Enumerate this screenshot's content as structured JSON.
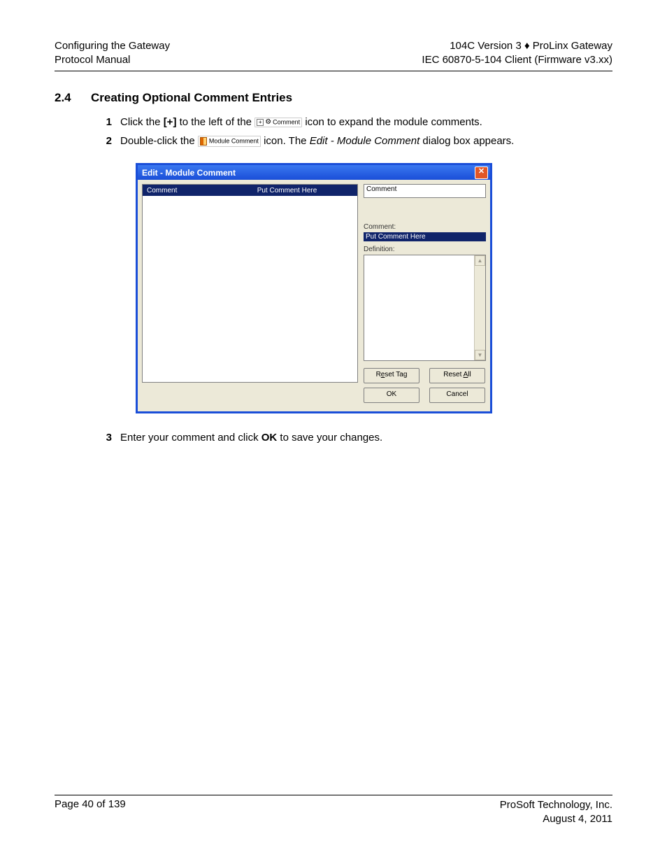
{
  "header": {
    "left_line1": "Configuring the  Gateway",
    "left_line2": "Protocol Manual",
    "right_line1": "104C Version 3 ♦ ProLinx Gateway",
    "right_line2": "IEC 60870-5-104 Client (Firmware v3.xx)"
  },
  "section": {
    "number": "2.4",
    "title": "Creating Optional Comment Entries"
  },
  "steps": {
    "s1a": "Click the ",
    "s1_bold1": "[+]",
    "s1b": " to the left of the  ",
    "icon1_label": "Comment",
    "s1c": "  icon to expand the module comments.",
    "s2a": "Double-click the  ",
    "icon2_label": "Module Comment",
    "s2b": "  icon. The ",
    "s2_italic": "Edit - Module Comment",
    "s2c": " dialog box appears.",
    "s3a": "Enter your comment and click ",
    "s3_bold": "OK",
    "s3b": " to save your changes."
  },
  "dialog": {
    "title": "Edit - Module Comment",
    "col1": "Comment",
    "col2": "Put Comment Here",
    "right_input_value": "Comment",
    "comment_label": "Comment:",
    "comment_value": "Put Comment Here",
    "definition_label": "Definition:",
    "btn_reset_tag_pre": "R",
    "btn_reset_tag_u": "e",
    "btn_reset_tag_post": "set Tag",
    "btn_reset_all_pre": "Reset ",
    "btn_reset_all_u": "A",
    "btn_reset_all_post": "ll",
    "btn_ok": "OK",
    "btn_cancel": "Cancel"
  },
  "footer": {
    "left": "Page 40 of 139",
    "right_line1": "ProSoft Technology, Inc.",
    "right_line2": "August 4, 2011"
  }
}
